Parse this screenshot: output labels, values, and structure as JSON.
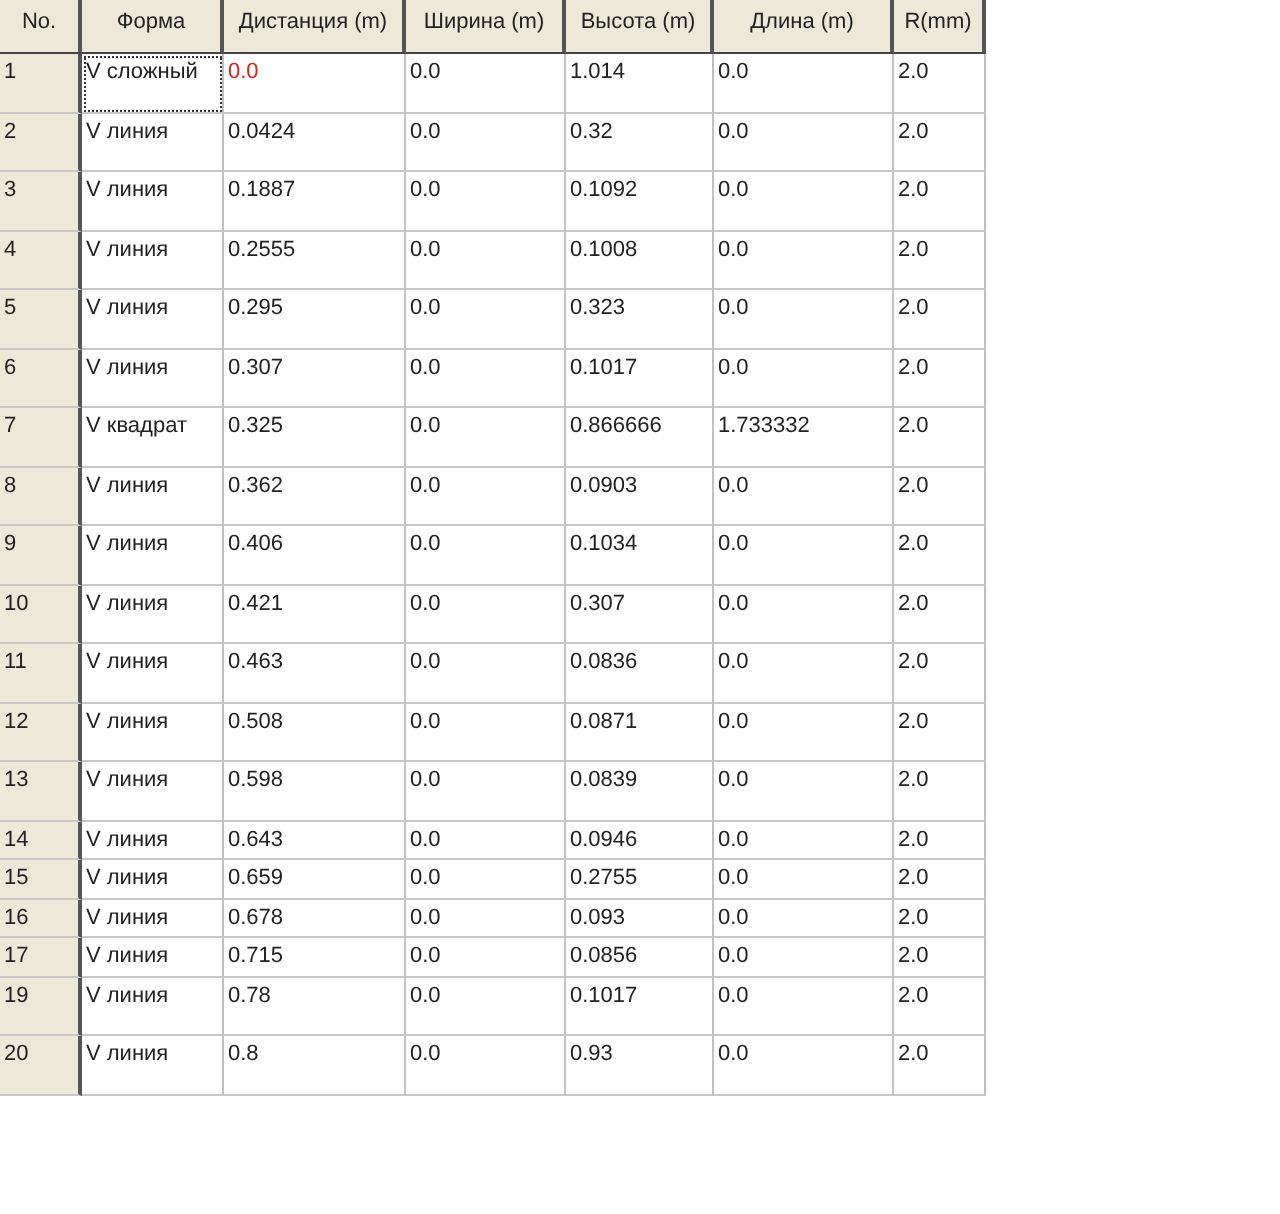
{
  "table": {
    "columns": [
      "No.",
      "Форма",
      "Дистанция (m)",
      "Ширина (m)",
      "Высота (m)",
      "Длина (m)",
      "R(mm)"
    ],
    "rows": [
      {
        "kind": "tall",
        "focused": true,
        "alert": true,
        "cells": [
          "1",
          "V сложный",
          "0.0",
          "0.0",
          "1.014",
          "0.0",
          "2.0"
        ]
      },
      {
        "kind": "tall",
        "focused": false,
        "alert": false,
        "cells": [
          "2",
          "V линия",
          "0.0424",
          "0.0",
          "0.32",
          "0.0",
          "2.0"
        ]
      },
      {
        "kind": "tall",
        "focused": false,
        "alert": false,
        "cells": [
          "3",
          "V линия",
          "0.1887",
          "0.0",
          "0.1092",
          "0.0",
          "2.0"
        ]
      },
      {
        "kind": "tall",
        "focused": false,
        "alert": false,
        "cells": [
          "4",
          "V линия",
          "0.2555",
          "0.0",
          "0.1008",
          "0.0",
          "2.0"
        ]
      },
      {
        "kind": "tall",
        "focused": false,
        "alert": false,
        "cells": [
          "5",
          "V линия",
          "0.295",
          "0.0",
          "0.323",
          "0.0",
          "2.0"
        ]
      },
      {
        "kind": "tall",
        "focused": false,
        "alert": false,
        "cells": [
          "6",
          "V линия",
          "0.307",
          "0.0",
          "0.1017",
          "0.0",
          "2.0"
        ]
      },
      {
        "kind": "tall",
        "focused": false,
        "alert": false,
        "cells": [
          "7",
          "V квадрат",
          "0.325",
          "0.0",
          "0.866666",
          "1.733332",
          "2.0"
        ]
      },
      {
        "kind": "tall",
        "focused": false,
        "alert": false,
        "cells": [
          "8",
          "V линия",
          "0.362",
          "0.0",
          "0.0903",
          "0.0",
          "2.0"
        ]
      },
      {
        "kind": "tall",
        "focused": false,
        "alert": false,
        "cells": [
          "9",
          "V линия",
          "0.406",
          "0.0",
          "0.1034",
          "0.0",
          "2.0"
        ]
      },
      {
        "kind": "tall",
        "focused": false,
        "alert": false,
        "cells": [
          "10",
          "V линия",
          "0.421",
          "0.0",
          "0.307",
          "0.0",
          "2.0"
        ]
      },
      {
        "kind": "tall",
        "focused": false,
        "alert": false,
        "cells": [
          "11",
          "V линия",
          "0.463",
          "0.0",
          "0.0836",
          "0.0",
          "2.0"
        ]
      },
      {
        "kind": "tall",
        "focused": false,
        "alert": false,
        "cells": [
          "12",
          "V линия",
          "0.508",
          "0.0",
          "0.0871",
          "0.0",
          "2.0"
        ]
      },
      {
        "kind": "tall",
        "focused": false,
        "alert": false,
        "cells": [
          "13",
          "V линия",
          "0.598",
          "0.0",
          "0.0839",
          "0.0",
          "2.0"
        ]
      },
      {
        "kind": "short",
        "focused": false,
        "alert": false,
        "cells": [
          "14",
          "V линия",
          "0.643",
          "0.0",
          "0.0946",
          "0.0",
          "2.0"
        ]
      },
      {
        "kind": "short",
        "focused": false,
        "alert": false,
        "cells": [
          "15",
          "V линия",
          "0.659",
          "0.0",
          "0.2755",
          "0.0",
          "2.0"
        ]
      },
      {
        "kind": "short",
        "focused": false,
        "alert": false,
        "cells": [
          "16",
          "V линия",
          "0.678",
          "0.0",
          "0.093",
          "0.0",
          "2.0"
        ]
      },
      {
        "kind": "short",
        "focused": false,
        "alert": false,
        "cells": [
          "17",
          "V линия",
          "0.715",
          "0.0",
          "0.0856",
          "0.0",
          "2.0"
        ]
      },
      {
        "kind": "tall",
        "focused": false,
        "alert": false,
        "cells": [
          "19",
          "V линия",
          "0.78",
          "0.0",
          "0.1017",
          "0.0",
          "2.0"
        ]
      },
      {
        "kind": "tall",
        "focused": false,
        "alert": false,
        "cells": [
          "20",
          "V линия",
          "0.8",
          "0.0",
          "0.93",
          "0.0",
          "2.0"
        ]
      }
    ]
  }
}
